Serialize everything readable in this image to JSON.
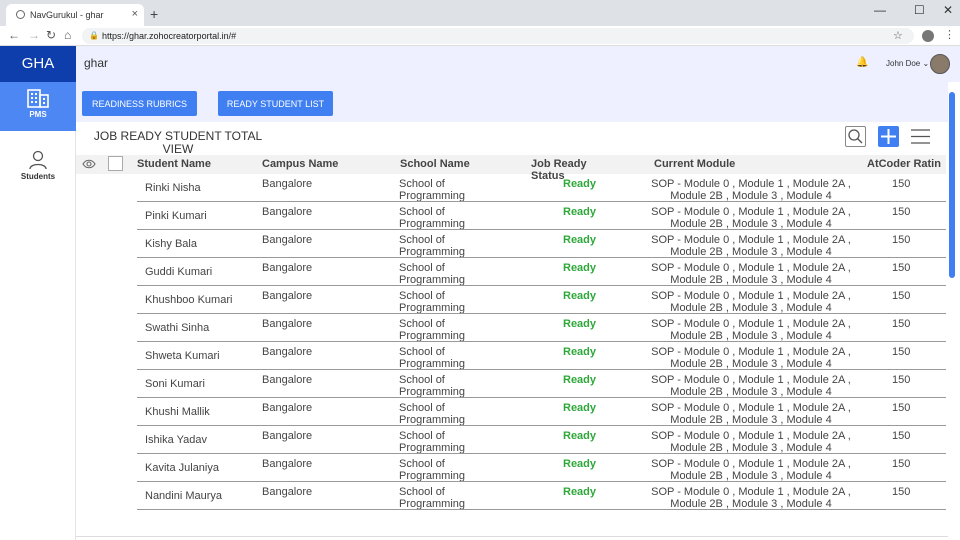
{
  "browser": {
    "tab_title": "NavGurukul - ghar",
    "url": "https://ghar.zohocreatorportal.in/#",
    "new_tab": "+",
    "minimize": "—",
    "maximize": "☐",
    "close": "✕"
  },
  "app": {
    "logo": "GHA",
    "title": "ghar",
    "user_name": "John Doe"
  },
  "sidebar": {
    "items": [
      {
        "label": "PMS",
        "icon": "building-icon"
      },
      {
        "label": "Students",
        "icon": "person-icon"
      }
    ]
  },
  "buttons": {
    "readiness": "READINESS RUBRICS",
    "ready_list": "READY STUDENT LIST"
  },
  "view_title_line1": "JOB READY STUDENT TOTAL",
  "view_title_line2": "VIEW",
  "table": {
    "headers": {
      "name": "Student Name",
      "campus": "Campus Name",
      "school": "School Name",
      "status1": "Job Ready",
      "status2": "Status",
      "module": "Current Module",
      "rating": "AtCoder Ratin"
    },
    "school_line1": "School of",
    "school_line2": "Programming",
    "module_line1": "SOP - Module 0 , Module 1 , Module 2A ,",
    "module_line2": "Module 2B , Module 3 , Module 4",
    "rows": [
      {
        "name": "Rinki Nisha",
        "campus": "Bangalore",
        "status": "Ready",
        "rating": "150"
      },
      {
        "name": "Pinki Kumari",
        "campus": "Bangalore",
        "status": "Ready",
        "rating": "150"
      },
      {
        "name": "Kishy Bala",
        "campus": "Bangalore",
        "status": "Ready",
        "rating": "150"
      },
      {
        "name": "Guddi Kumari",
        "campus": "Bangalore",
        "status": "Ready",
        "rating": "150"
      },
      {
        "name": "Khushboo Kumari",
        "campus": "Bangalore",
        "status": "Ready",
        "rating": "150"
      },
      {
        "name": "Swathi Sinha",
        "campus": "Bangalore",
        "status": "Ready",
        "rating": "150"
      },
      {
        "name": "Shweta Kumari",
        "campus": "Bangalore",
        "status": "Ready",
        "rating": "150"
      },
      {
        "name": "Soni Kumari",
        "campus": "Bangalore",
        "status": "Ready",
        "rating": "150"
      },
      {
        "name": "Khushi Mallik",
        "campus": "Bangalore",
        "status": "Ready",
        "rating": "150"
      },
      {
        "name": "Ishika Yadav",
        "campus": "Bangalore",
        "status": "Ready",
        "rating": "150"
      },
      {
        "name": "Kavita Julaniya",
        "campus": "Bangalore",
        "status": "Ready",
        "rating": "150"
      },
      {
        "name": "Nandini Maurya",
        "campus": "Bangalore",
        "status": "Ready",
        "rating": "150"
      }
    ]
  },
  "colors": {
    "brand": "#0d3eab",
    "accent": "#3f7ff2",
    "ready": "#2fa83a"
  }
}
